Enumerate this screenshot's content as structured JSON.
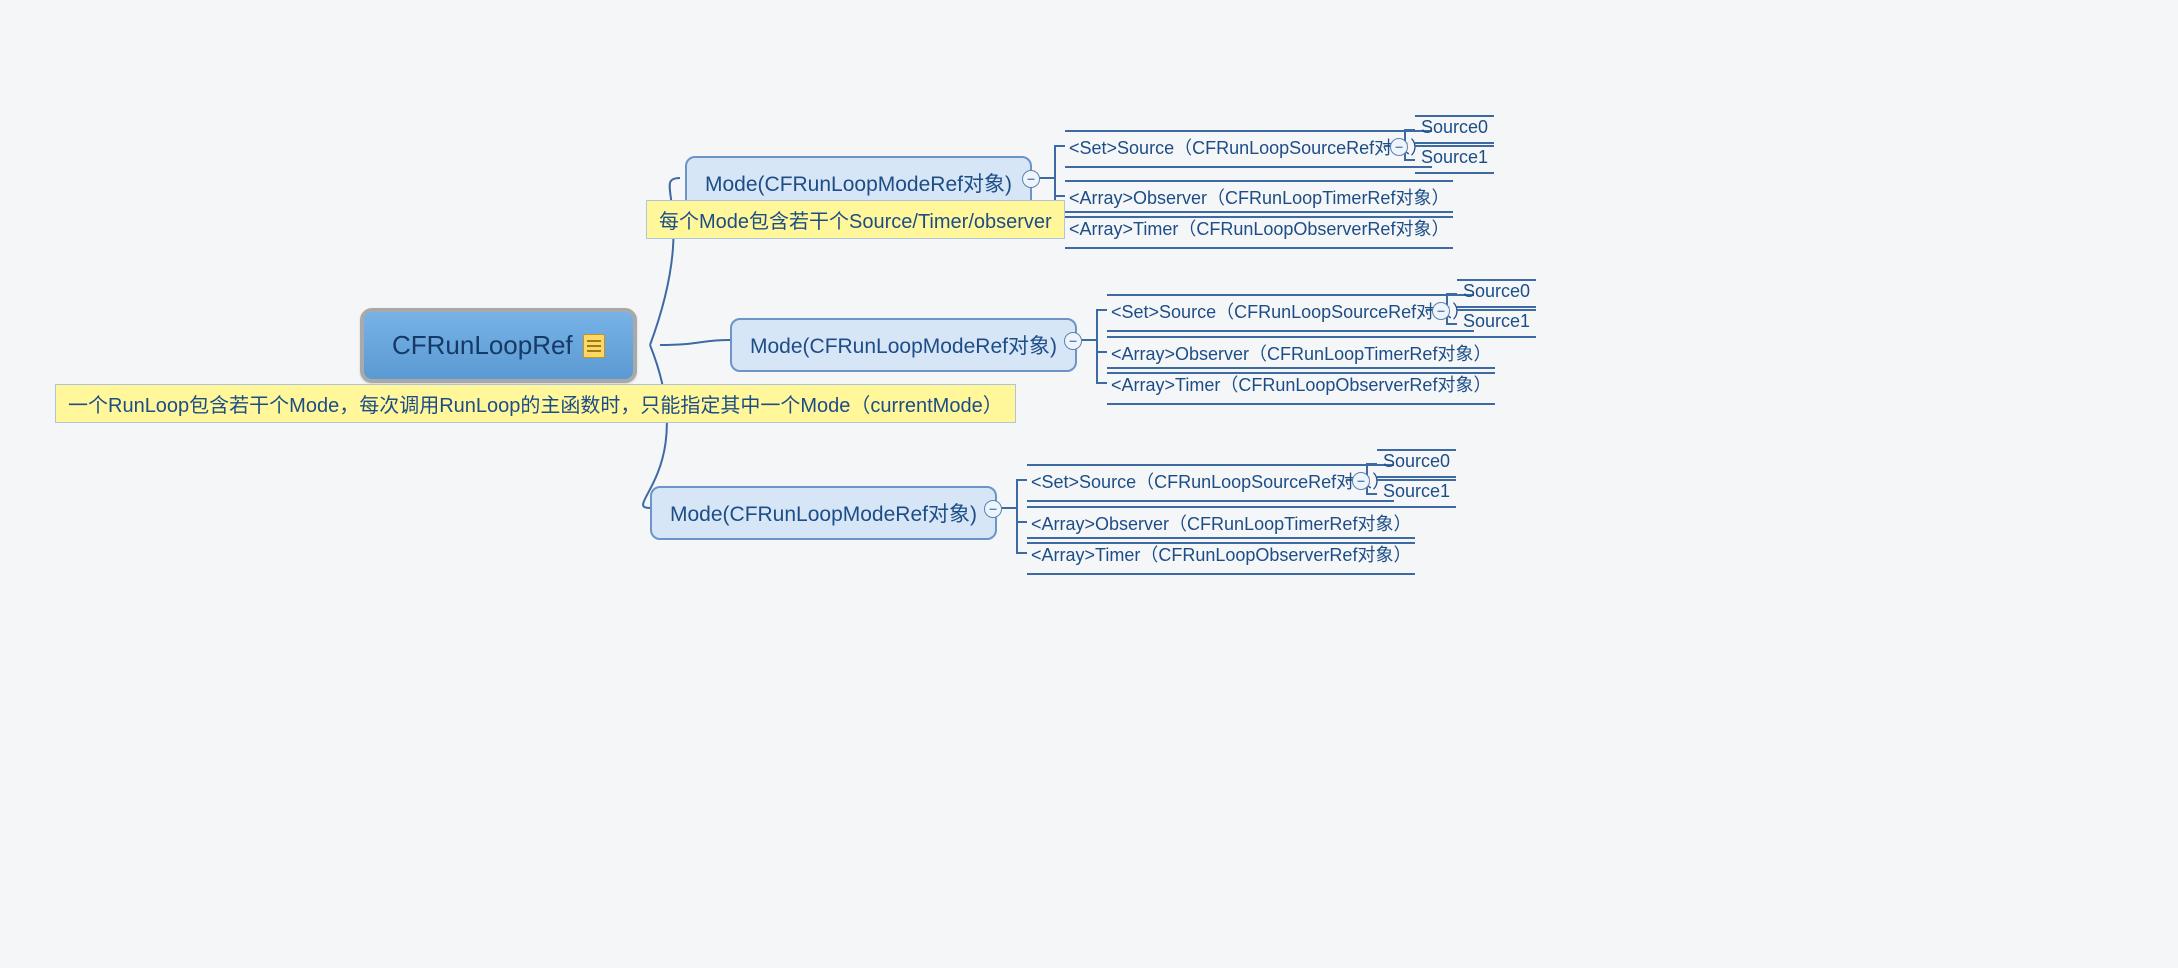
{
  "root": {
    "label": "CFRunLoopRef",
    "caption": "一个RunLoop包含若干个Mode，每次调用RunLoop的主函数时，只能指定其中一个Mode（currentMode）"
  },
  "modes": [
    {
      "label": "Mode(CFRunLoopModeRef对象)",
      "caption": "每个Mode包含若干个Source/Timer/observer",
      "items": {
        "source": "<Set>Source（CFRunLoopSourceRef对象）",
        "observer": "<Array>Observer（CFRunLoopTimerRef对象）",
        "timer": "<Array>Timer（CFRunLoopObserverRef对象）"
      },
      "sources": {
        "a": "Source0",
        "b": "Source1"
      }
    },
    {
      "label": "Mode(CFRunLoopModeRef对象)",
      "items": {
        "source": "<Set>Source（CFRunLoopSourceRef对象）",
        "observer": "<Array>Observer（CFRunLoopTimerRef对象）",
        "timer": "<Array>Timer（CFRunLoopObserverRef对象）"
      },
      "sources": {
        "a": "Source0",
        "b": "Source1"
      }
    },
    {
      "label": "Mode(CFRunLoopModeRef对象)",
      "items": {
        "source": "<Set>Source（CFRunLoopSourceRef对象）",
        "observer": "<Array>Observer（CFRunLoopTimerRef对象）",
        "timer": "<Array>Timer（CFRunLoopObserverRef对象）"
      },
      "sources": {
        "a": "Source0",
        "b": "Source1"
      }
    }
  ],
  "toggle_symbol": "–"
}
